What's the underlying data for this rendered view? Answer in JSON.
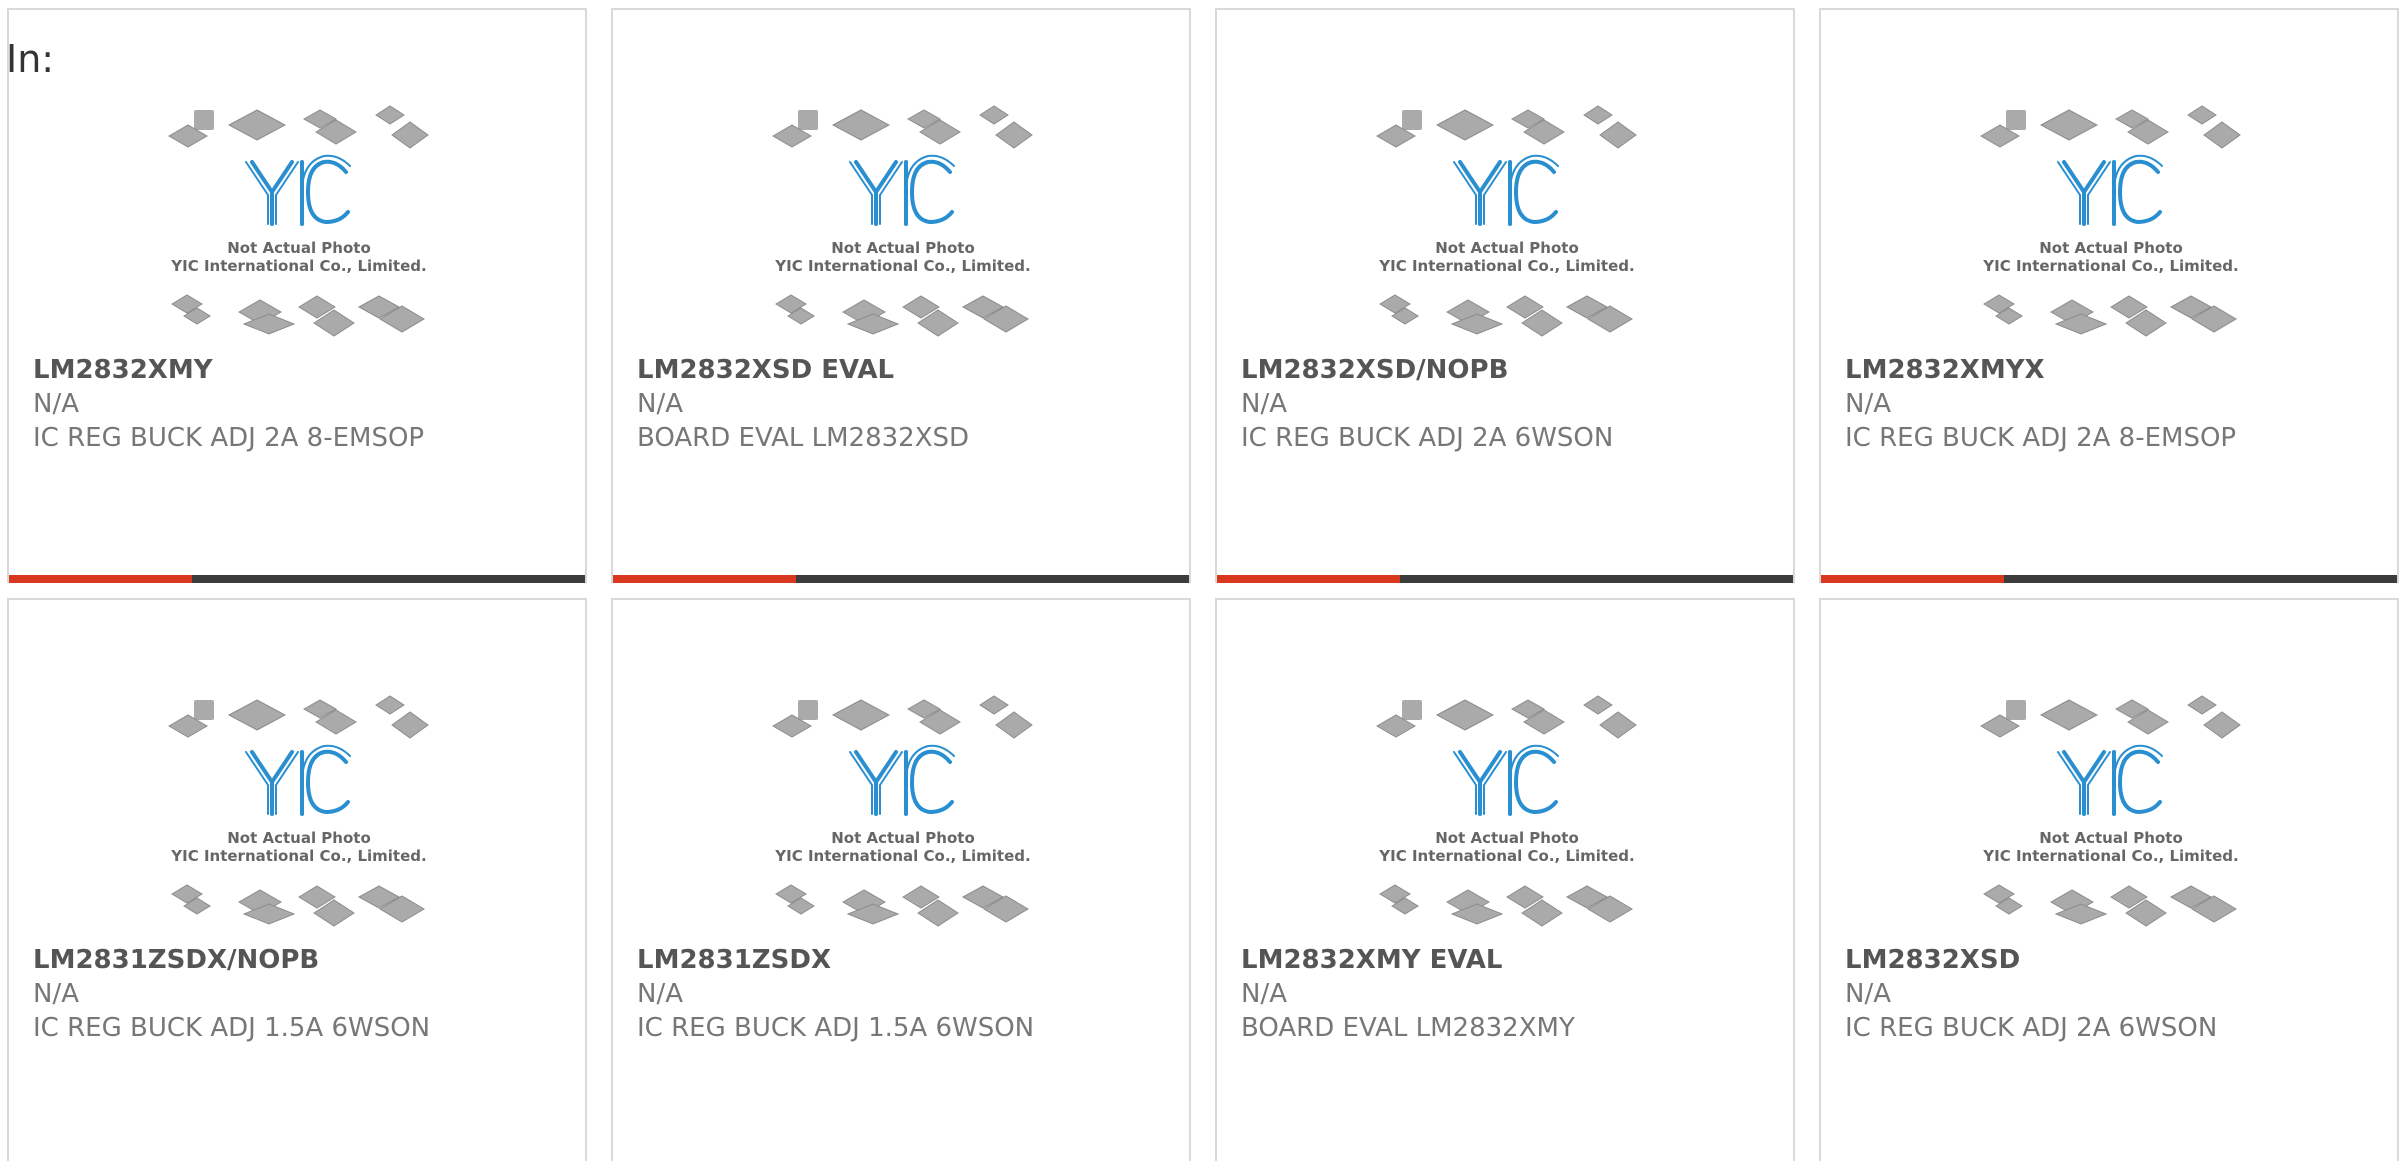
{
  "header": {
    "in_label": "In:"
  },
  "placeholder_image": {
    "line1": "Not Actual Photo",
    "line2": "YIC International Co., Limited.",
    "logo_text": "YIC"
  },
  "colors": {
    "accent": "#d9381e",
    "bar_dark": "#3c3c3c",
    "logo_blue": "#2a8fd0",
    "chip_gray": "#aaaaaa"
  },
  "products": [
    {
      "part": "LM2832XMY",
      "mfr": "N/A",
      "desc": "IC REG BUCK ADJ 2A 8-EMSOP"
    },
    {
      "part": "LM2832XSD EVAL",
      "mfr": "N/A",
      "desc": "BOARD EVAL LM2832XSD"
    },
    {
      "part": "LM2832XSD/NOPB",
      "mfr": "N/A",
      "desc": "IC REG BUCK ADJ 2A 6WSON"
    },
    {
      "part": "LM2832XMYX",
      "mfr": "N/A",
      "desc": "IC REG BUCK ADJ 2A 8-EMSOP"
    },
    {
      "part": "LM2831ZSDX/NOPB",
      "mfr": "N/A",
      "desc": "IC REG BUCK ADJ 1.5A 6WSON"
    },
    {
      "part": "LM2831ZSDX",
      "mfr": "N/A",
      "desc": "IC REG BUCK ADJ 1.5A 6WSON"
    },
    {
      "part": "LM2832XMY EVAL",
      "mfr": "N/A",
      "desc": "BOARD EVAL LM2832XMY"
    },
    {
      "part": "LM2832XSD",
      "mfr": "N/A",
      "desc": "IC REG BUCK ADJ 2A 6WSON"
    }
  ]
}
